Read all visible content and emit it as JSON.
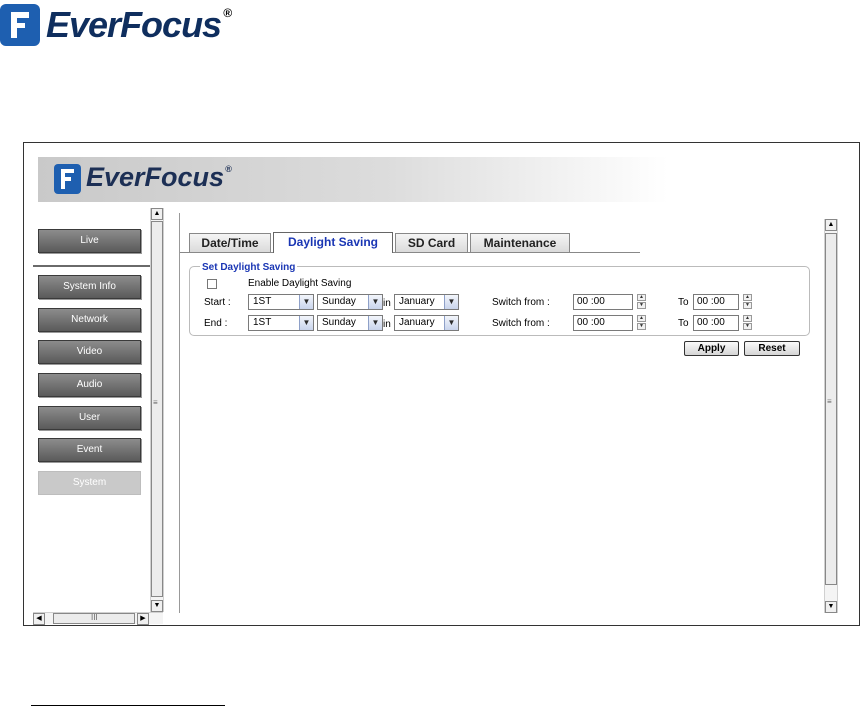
{
  "doc_header": {
    "brand": "EverFocus",
    "reg_mark": "®"
  },
  "banner": {
    "brand": "EverFocus",
    "reg_mark": "®"
  },
  "nav": {
    "items": [
      {
        "label": "Live"
      },
      {
        "label": "System Info"
      },
      {
        "label": "Network"
      },
      {
        "label": "Video"
      },
      {
        "label": "Audio"
      },
      {
        "label": "User"
      },
      {
        "label": "Event"
      },
      {
        "label": "System"
      }
    ],
    "active": "System"
  },
  "tabs": [
    {
      "label": "Date/Time"
    },
    {
      "label": "Daylight Saving"
    },
    {
      "label": "SD Card"
    },
    {
      "label": "Maintenance"
    }
  ],
  "active_tab": "Daylight Saving",
  "daylight": {
    "legend": "Set Daylight Saving",
    "enable_label": "Enable Daylight Saving",
    "enable_checked": false,
    "start": {
      "label": "Start :",
      "week": "1ST",
      "day": "Sunday",
      "in_label": "in",
      "month": "January",
      "switch_label": "Switch from :",
      "from_time": "00 :00",
      "to_label": "To",
      "to_time": "00 :00"
    },
    "end": {
      "label": "End :",
      "week": "1ST",
      "day": "Sunday",
      "in_label": "in",
      "month": "January",
      "switch_label": "Switch from :",
      "from_time": "00 :00",
      "to_label": "To",
      "to_time": "00 :00"
    }
  },
  "buttons": {
    "apply": "Apply",
    "reset": "Reset"
  },
  "colors": {
    "brand_blue": "#1e5fb0",
    "tab_active_text": "#1a36b4",
    "nav_button": "#6e6e6e"
  }
}
